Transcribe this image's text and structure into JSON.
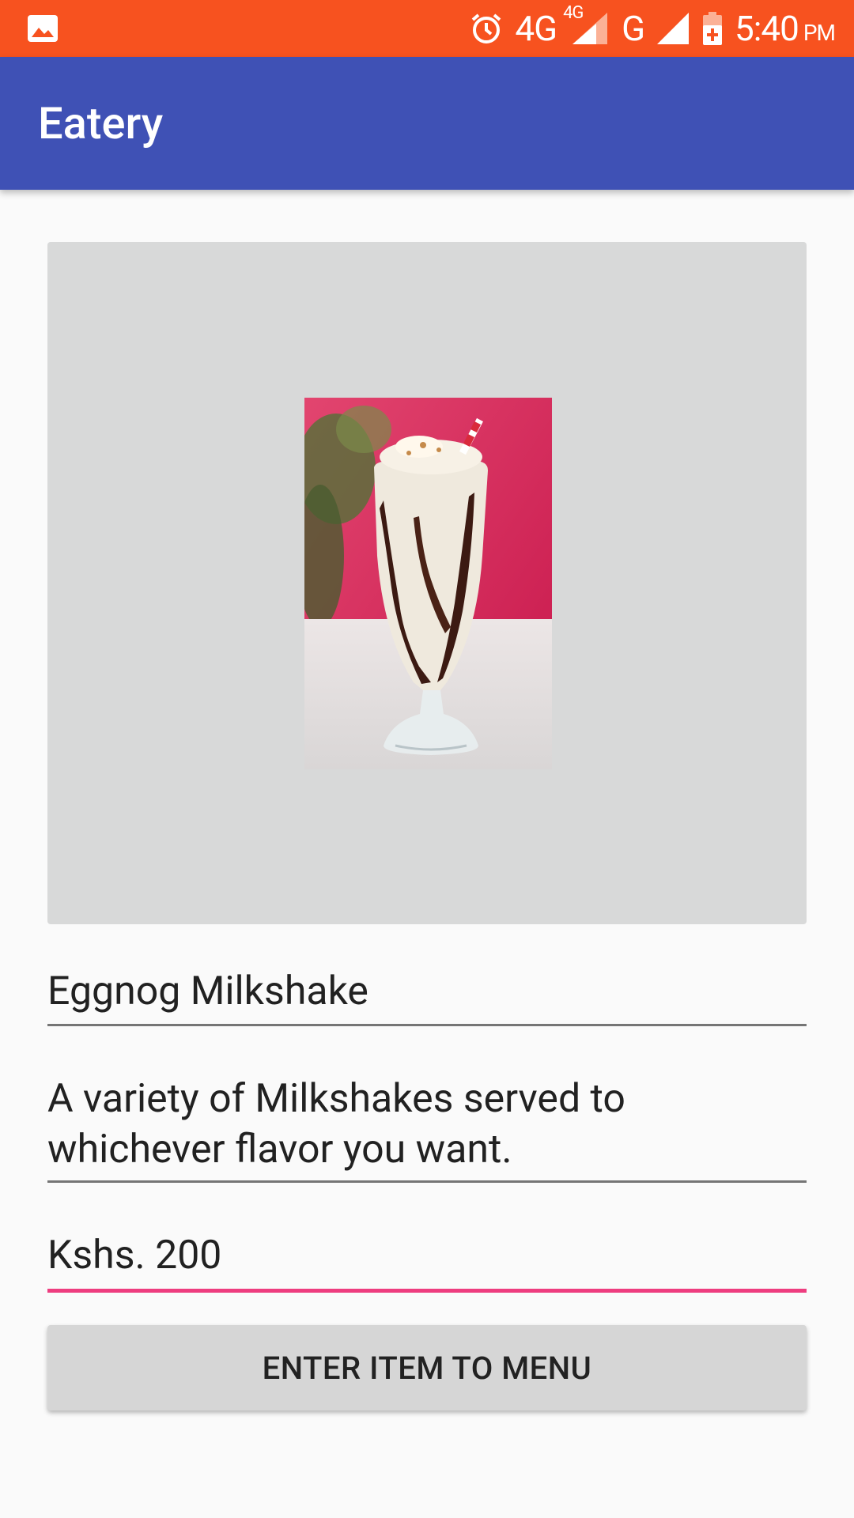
{
  "status_bar": {
    "network_4g": "4G",
    "network_4g_small": "4G",
    "network_g": "G",
    "time": "5:40",
    "ampm": "PM",
    "bg_color": "#f7521f"
  },
  "app_bar": {
    "title": "Eatery",
    "bg_color": "#3f51b5"
  },
  "item_image": {
    "icon": "milkshake-photo"
  },
  "form": {
    "name_value": "Eggnog Milkshake",
    "description_value": "A variety of Milkshakes served to whichever flavor you want.",
    "price_value": "Kshs. 200",
    "focused_field_color": "#ee3d7f"
  },
  "button": {
    "label": "ENTER ITEM TO MENU"
  }
}
